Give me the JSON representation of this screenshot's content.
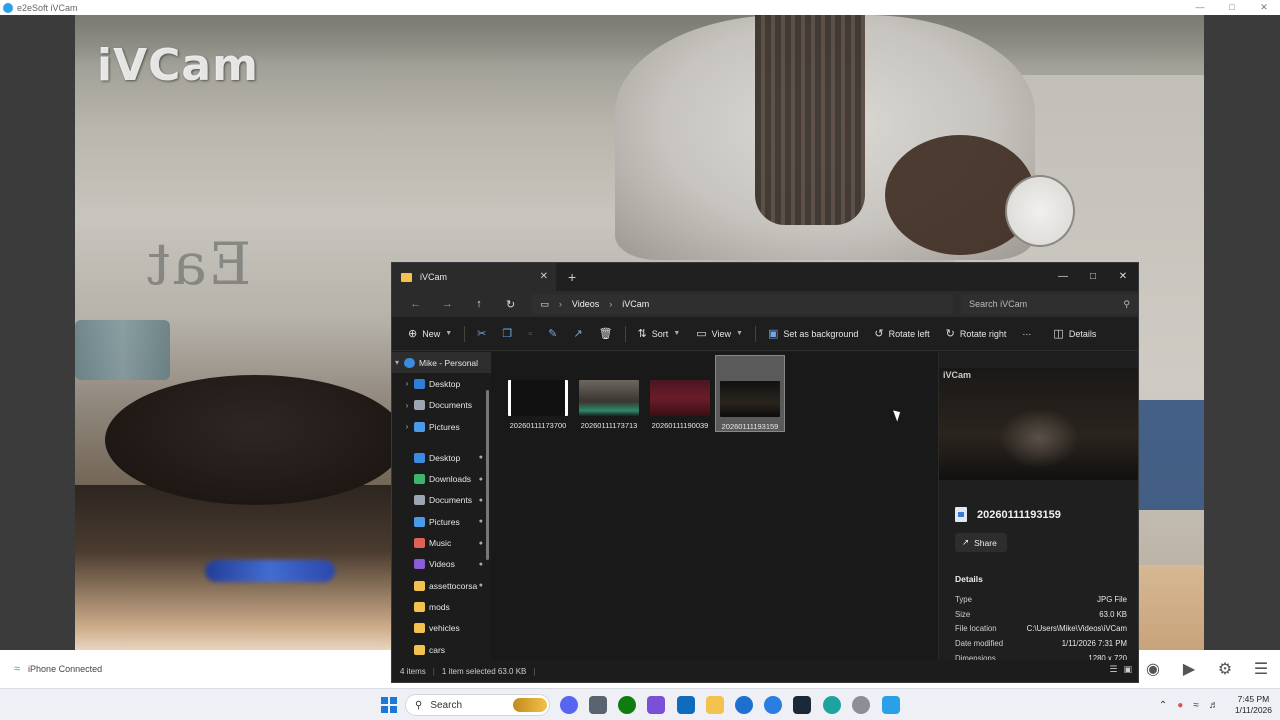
{
  "ivcam": {
    "window_title": "e2eSoft iVCam",
    "watermark": "iVCam",
    "sign_text": "Eat",
    "status_text": "iPhone Connected",
    "tools": [
      "camera-icon",
      "video-camera-icon",
      "gear-icon",
      "menu-icon"
    ]
  },
  "explorer": {
    "tab_title": "iVCam",
    "breadcrumb": [
      "Videos",
      "iVCam"
    ],
    "search_placeholder": "Search iVCam",
    "toolbar": {
      "new_label": "New",
      "sort_label": "Sort",
      "view_label": "View",
      "set_background_label": "Set as background",
      "rotate_left_label": "Rotate left",
      "rotate_right_label": "Rotate right",
      "more_label": "···",
      "details_label": "Details"
    },
    "nav": {
      "root_label": "Mike - Personal",
      "tree": [
        "Desktop",
        "Documents",
        "Pictures"
      ],
      "quick": [
        {
          "label": "Desktop",
          "color": "#3b8be0",
          "pinned": true
        },
        {
          "label": "Downloads",
          "color": "#3fb56b",
          "pinned": true
        },
        {
          "label": "Documents",
          "color": "#9aa6b2",
          "pinned": true
        },
        {
          "label": "Pictures",
          "color": "#4a9be8",
          "pinned": true
        },
        {
          "label": "Music",
          "color": "#e0605a",
          "pinned": true
        },
        {
          "label": "Videos",
          "color": "#8a5cd6",
          "pinned": true
        },
        {
          "label": "assettocorsa",
          "color": "#f2c14e",
          "pinned": true
        },
        {
          "label": "mods",
          "color": "#f2c14e",
          "pinned": false
        },
        {
          "label": "vehicles",
          "color": "#f2c14e",
          "pinned": false
        },
        {
          "label": "cars",
          "color": "#f2c14e",
          "pinned": false
        }
      ]
    },
    "files": [
      {
        "name": "20260111173700",
        "selected": false
      },
      {
        "name": "20260111173713",
        "selected": false
      },
      {
        "name": "20260111190039",
        "selected": false
      },
      {
        "name": "20260111193159",
        "selected": true
      }
    ],
    "details": {
      "preview_watermark": "iVCam",
      "file_name": "20260111193159",
      "share_label": "Share",
      "section_label": "Details",
      "props": [
        {
          "k": "Type",
          "v": "JPG File"
        },
        {
          "k": "Size",
          "v": "63.0 KB"
        },
        {
          "k": "File location",
          "v": "C:\\Users\\Mike\\Videos\\iVCam"
        },
        {
          "k": "Date modified",
          "v": "1/11/2026 7:31 PM"
        },
        {
          "k": "Dimensions",
          "v": "1280 x 720"
        }
      ]
    },
    "status": {
      "items": "4 items",
      "selection": "1 item selected  63.0 KB"
    }
  },
  "taskbar": {
    "search_label": "Search",
    "time": "7:45 PM",
    "date": "1/11/2026"
  }
}
